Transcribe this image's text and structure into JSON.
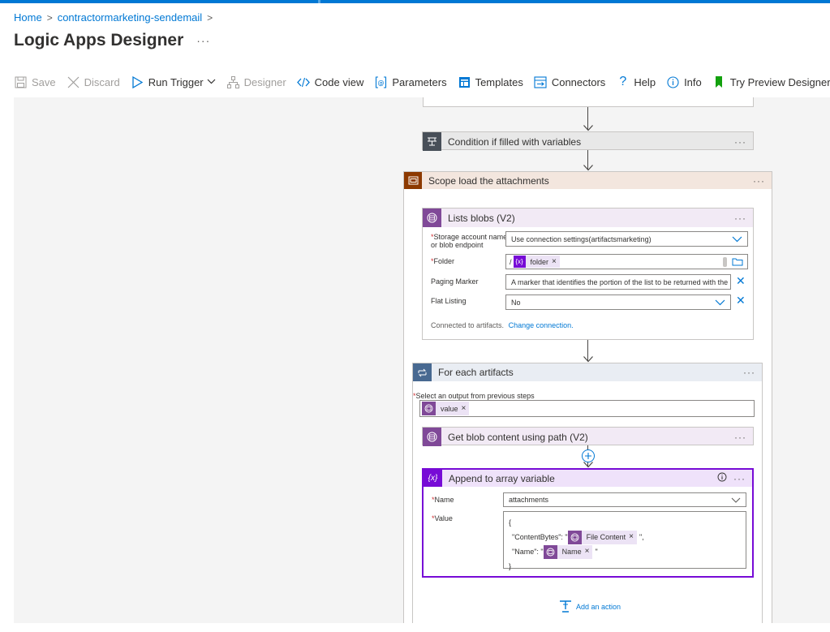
{
  "breadcrumb": {
    "home": "Home",
    "separator": ">",
    "app": "contractormarketing-sendemail"
  },
  "page": {
    "title": "Logic Apps Designer",
    "more": "···"
  },
  "toolbar": {
    "save": "Save",
    "discard": "Discard",
    "run_trigger": "Run Trigger",
    "designer": "Designer",
    "code_view": "Code view",
    "parameters": "Parameters",
    "templates": "Templates",
    "connectors": "Connectors",
    "help": "Help",
    "info": "Info",
    "try_preview": "Try Preview Designer"
  },
  "canvas": {
    "condition": {
      "title": "Condition if filled with variables",
      "more": "···"
    },
    "scope": {
      "title": "Scope load the attachments",
      "more": "···"
    },
    "list_blobs": {
      "title": "Lists blobs (V2)",
      "more": "···",
      "storage_label": "Storage account name or blob endpoint",
      "storage_value": "Use connection settings(artifactsmarketing)",
      "folder_label": "Folder",
      "folder_prefix": "/",
      "folder_token": "folder",
      "paging_label": "Paging Marker",
      "paging_placeholder": "A marker that identifies the portion of the list to be returned with the list",
      "flat_label": "Flat Listing",
      "flat_value": "No",
      "connected_text": "Connected to artifacts.",
      "change_connection": "Change connection."
    },
    "for_each": {
      "title": "For each artifacts",
      "more": "···",
      "select_label": "Select an output from previous steps",
      "value_token": "value"
    },
    "get_blob": {
      "title": "Get blob content using path (V2)",
      "more": "···"
    },
    "append": {
      "title": "Append to array variable",
      "more": "···",
      "name_label": "Name",
      "name_value": "attachments",
      "value_label": "Value",
      "line1": "{",
      "content_bytes_key": "\"ContentBytes\": \"",
      "file_content_token": "File Content",
      "content_bytes_end": "\",",
      "name_key": "\"Name\": \"",
      "name_token": "Name",
      "name_end": "\"",
      "line_end": "}"
    },
    "add_action": "Add an action"
  },
  "icons": {
    "token_x": "×",
    "close_x": "✕"
  },
  "colors": {
    "accent": "#0078d4",
    "condition_header": "#e8e8e8",
    "condition_icon": "#484f58",
    "scope_icon": "#8c3900",
    "scope_header": "#f3e6de",
    "blob_icon": "#804998",
    "blob_header": "#f2eaf5",
    "foreach_icon": "#486991",
    "foreach_header": "#e9edf3",
    "variable_icon": "#770bd6",
    "required": "#d13438"
  }
}
